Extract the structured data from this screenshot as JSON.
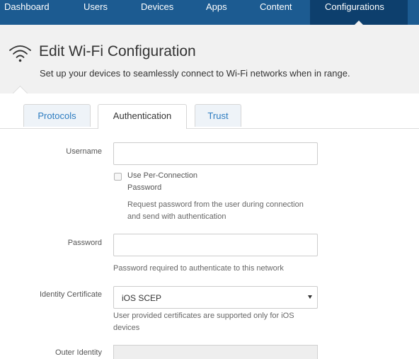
{
  "topnav": {
    "items": [
      {
        "label": "Dashboard"
      },
      {
        "label": "Users"
      },
      {
        "label": "Devices"
      },
      {
        "label": "Apps"
      },
      {
        "label": "Content"
      },
      {
        "label": "Configurations",
        "active": true
      }
    ]
  },
  "header": {
    "icon": "wifi-icon",
    "title": "Edit Wi-Fi Configuration",
    "subtitle": "Set up your devices to seamlessly connect to Wi-Fi networks when in range."
  },
  "tabs": [
    {
      "label": "Protocols",
      "active": false
    },
    {
      "label": "Authentication",
      "active": true
    },
    {
      "label": "Trust",
      "active": false
    }
  ],
  "form": {
    "username": {
      "label": "Username",
      "value": ""
    },
    "per_connection": {
      "label_line1": "Use Per-Connection",
      "label_line2": "Password",
      "checked": false,
      "help_line1": "Request password from the user during connection",
      "help_line2": "and send with authentication"
    },
    "password": {
      "label": "Password",
      "value": "",
      "help": "Password required to authenticate to this network"
    },
    "identity_certificate": {
      "label": "Identity Certificate",
      "selected": "iOS SCEP",
      "help_line1": "User provided certificates are supported only for iOS",
      "help_line2": "devices"
    },
    "outer_identity": {
      "label": "Outer Identity"
    }
  },
  "colors": {
    "nav_bg": "#1c5b91",
    "nav_active_bg": "#0d3f6d",
    "header_bg": "#f1f1f1",
    "tab_inactive_bg": "#eef3f8",
    "tab_inactive_text": "#2b7bc0"
  }
}
